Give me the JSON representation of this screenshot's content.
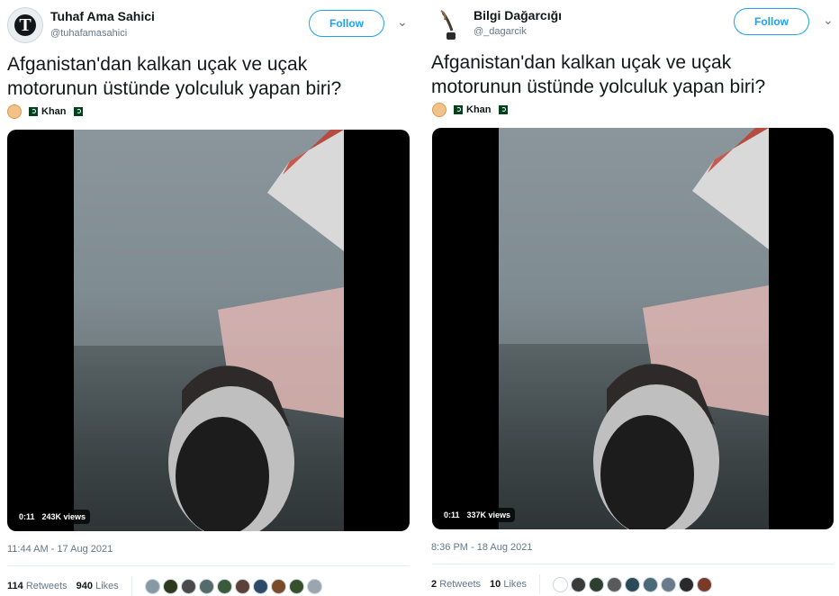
{
  "tweets": [
    {
      "name": "Tuhaf Ama Sahici",
      "handle": "@tuhafamasahici",
      "follow_label": "Follow",
      "text_line1": "Afganistan'dan kalkan uçak ve uçak",
      "text_line2": "motorunun üstünde yolculuk yapan biri?",
      "tag_name": "Khan",
      "video_duration": "0:11",
      "video_views": "243K views",
      "timestamp": "11:44 AM - 17 Aug 2021",
      "retweets_count": "114",
      "retweets_label": "Retweets",
      "likes_count": "940",
      "likes_label": "Likes",
      "liker_colors": [
        "#8899a6",
        "#2d3a1e",
        "#4a4a4a",
        "#556b6b",
        "#3a5a3a",
        "#5d4037",
        "#2e4a6a",
        "#7a4a2a",
        "#35502a",
        "#9aa5ad"
      ]
    },
    {
      "name": "Bilgi Dağarcığı",
      "handle": "@_dagarcik",
      "follow_label": "Follow",
      "text_line1": "Afganistan'dan kalkan uçak ve uçak",
      "text_line2": "motorunun üstünde yolculuk yapan biri?",
      "tag_name": "Khan",
      "video_duration": "0:11",
      "video_views": "337K views",
      "timestamp": "8:36 PM - 18 Aug 2021",
      "retweets_count": "2",
      "retweets_label": "Retweets",
      "likes_count": "10",
      "likes_label": "Likes",
      "liker_colors": [
        "#ffffff",
        "#3a3a3a",
        "#2f3f2f",
        "#5a5a5a",
        "#2a4a5a",
        "#4a6a7a",
        "#6a7a8a",
        "#2a2a2a",
        "#7a3a2a"
      ]
    }
  ],
  "colors": {
    "accent": "#1da1f2",
    "muted": "#657786"
  },
  "icons": {
    "chevron": "chevron-down-icon",
    "pakistan_flag": "pakistan-flag-icon"
  }
}
